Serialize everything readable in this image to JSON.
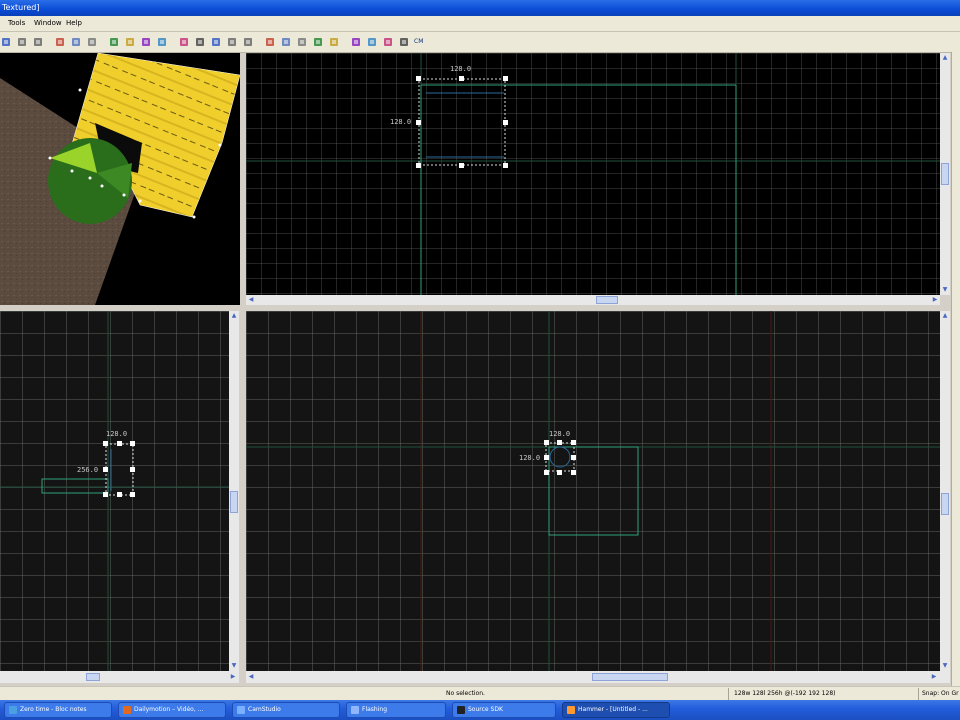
{
  "window": {
    "title_fragment": "Textured]"
  },
  "menu": {
    "items": [
      "Tools",
      "Window",
      "Help"
    ]
  },
  "toolbar": {
    "buttons": [
      "select-icon",
      "undo-icon",
      "redo-icon",
      "cut-icon",
      "copy-icon",
      "paste-icon",
      "group-icon",
      "ungroup-icon",
      "hide-icon",
      "texture-lock-icon",
      "grid-icon",
      "snap-icon",
      "camera-icon",
      "entity-icon",
      "clip-icon",
      "vertex-icon",
      "decal-icon",
      "overlay-icon",
      "carve-icon",
      "merge-icon",
      "map-properties-icon",
      "run-map-icon",
      "compile-icon",
      "cordon-icon"
    ],
    "cm_label": "CM"
  },
  "viewports": {
    "top": {
      "width_label": "128.0",
      "height_label": "128.0"
    },
    "side": {
      "width_label": "128.0",
      "height_label": "256.0"
    },
    "front": {
      "width_label": "128.0",
      "height_label": "128.0"
    }
  },
  "status": {
    "message": "No selection.",
    "size_info": "128w 128l 256h @(-192 192 128)",
    "snap": "Snap: On Gr"
  },
  "taskbar": {
    "tasks": [
      {
        "label": "Zero time - Bloc notes",
        "color": "#4aa0e0"
      },
      {
        "label": "Dailymotion – Vidéo, ...",
        "color": "#e06a20"
      },
      {
        "label": "CamStudio",
        "color": "#7ab0ff"
      },
      {
        "label": "Flashing",
        "color": "#8fb6ff"
      },
      {
        "label": "Source SDK",
        "color": "#222222"
      },
      {
        "label": "Hammer - [Untitled - ...",
        "color": "#ff9a30"
      }
    ]
  },
  "colors": {
    "grid_major": "#1f4f3d",
    "brush_outline": "#2ea07a",
    "selection_handle": "#ffffff",
    "axis_red": "#4a1a14",
    "floor_yellow": "#f0cf2c",
    "cylinder_green": "#2a6e1c",
    "cylinder_light": "#9ad32a"
  }
}
